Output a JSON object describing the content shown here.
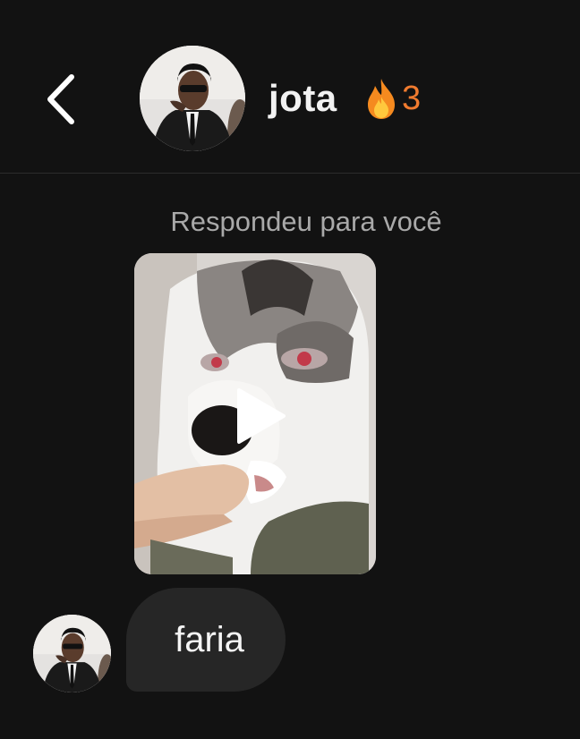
{
  "header": {
    "back_icon": "chevron-left-icon",
    "contact_name": "jota",
    "streak_icon": "fire-icon",
    "streak_count": "3"
  },
  "conversation": {
    "reply_label": "Respondeu para você",
    "media": {
      "type": "video",
      "play_icon": "play-icon"
    },
    "messages": [
      {
        "text": "faria"
      }
    ]
  },
  "colors": {
    "background": "#121212",
    "bubble": "#262626",
    "streak": "#f07b2f",
    "muted_text": "#a9a9a9"
  }
}
